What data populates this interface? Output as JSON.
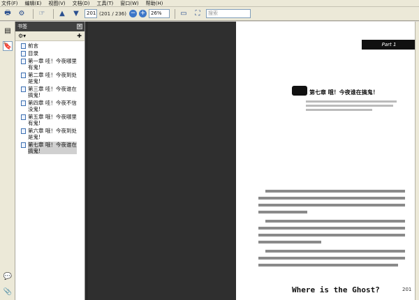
{
  "menu": [
    "文件(F)",
    "编辑(E)",
    "视图(V)",
    "文档(D)",
    "工具(T)",
    "窗口(W)",
    "帮助(H)"
  ],
  "toolbar": {
    "page_current": "201",
    "page_total": "(201 / 236)",
    "zoom": "26%",
    "search_placeholder": "搜索"
  },
  "panel": {
    "title": "书签",
    "close": "×"
  },
  "bookmarks": [
    {
      "label": "前言"
    },
    {
      "label": "目录"
    },
    {
      "label": "第一章  哇！今夜哪里有鬼!"
    },
    {
      "label": "第二章  哇！今夜到处是鬼!"
    },
    {
      "label": "第三章  哇！今夜谁在搞鬼!"
    },
    {
      "label": "第四章  哇！今夜不信没鬼!"
    },
    {
      "label": "第五章  哦！今夜哪里有鬼!"
    },
    {
      "label": "第六章  哦！今夜到处是鬼!"
    },
    {
      "label": "第七章  哦！今夜谁在搞鬼!"
    }
  ],
  "page": {
    "tab_label": "Part 1",
    "chapter_title": "第七章  哦！今夜谁在搞鬼！",
    "footer_title": "Where is the Ghost?",
    "page_number": "201"
  }
}
